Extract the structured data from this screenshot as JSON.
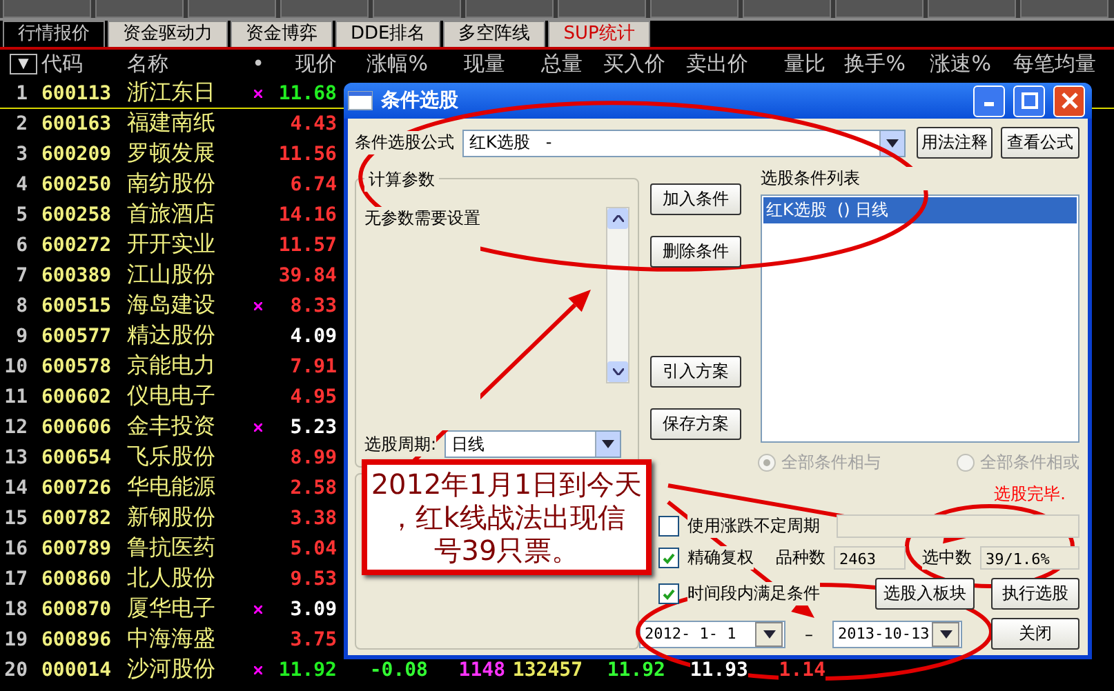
{
  "tabs": [
    {
      "label": "行情报价",
      "selected": true,
      "kind": "normal"
    },
    {
      "label": "资金驱动力",
      "selected": false,
      "kind": "normal"
    },
    {
      "label": "资金博弈",
      "selected": false,
      "kind": "normal"
    },
    {
      "label": "DDE排名",
      "selected": false,
      "kind": "normal"
    },
    {
      "label": "多空阵线",
      "selected": false,
      "kind": "normal"
    },
    {
      "label": "SUP统计",
      "selected": false,
      "kind": "alert"
    }
  ],
  "table": {
    "menu_glyph": "▼",
    "columns": [
      "代码",
      "名称",
      "•",
      "现价",
      "涨幅%",
      "现量",
      "总量",
      "买入价",
      "卖出价",
      "量比",
      "换手%",
      "涨速%",
      "每笔均量"
    ],
    "rows": [
      {
        "index": "1",
        "code": "600113",
        "name": "浙江东日",
        "flagged": true,
        "price": "11.68",
        "color": "#22ee22",
        "selected": true
      },
      {
        "index": "2",
        "code": "600163",
        "name": "福建南纸",
        "flagged": false,
        "price": "4.43",
        "color": "#ff3333",
        "selected": false
      },
      {
        "index": "3",
        "code": "600209",
        "name": "罗顿发展",
        "flagged": false,
        "price": "11.56",
        "color": "#ff3333",
        "selected": false
      },
      {
        "index": "4",
        "code": "600250",
        "name": "南纺股份",
        "flagged": false,
        "price": "6.74",
        "color": "#ff3333",
        "selected": false
      },
      {
        "index": "5",
        "code": "600258",
        "name": "首旅酒店",
        "flagged": false,
        "price": "14.16",
        "color": "#ff3333",
        "selected": false
      },
      {
        "index": "6",
        "code": "600272",
        "name": "开开实业",
        "flagged": false,
        "price": "11.57",
        "color": "#ff3333",
        "selected": false
      },
      {
        "index": "7",
        "code": "600389",
        "name": "江山股份",
        "flagged": false,
        "price": "39.84",
        "color": "#ff3333",
        "selected": false
      },
      {
        "index": "8",
        "code": "600515",
        "name": "海岛建设",
        "flagged": true,
        "price": "8.33",
        "color": "#ff3333",
        "selected": false
      },
      {
        "index": "9",
        "code": "600577",
        "name": "精达股份",
        "flagged": false,
        "price": "4.09",
        "color": "#ffffff",
        "selected": false
      },
      {
        "index": "10",
        "code": "600578",
        "name": "京能电力",
        "flagged": false,
        "price": "7.91",
        "color": "#ff3333",
        "selected": false
      },
      {
        "index": "11",
        "code": "600602",
        "name": "仪电电子",
        "flagged": false,
        "price": "4.95",
        "color": "#ff3333",
        "selected": false
      },
      {
        "index": "12",
        "code": "600606",
        "name": "金丰投资",
        "flagged": true,
        "price": "5.23",
        "color": "#ffffff",
        "selected": false
      },
      {
        "index": "13",
        "code": "600654",
        "name": "飞乐股份",
        "flagged": false,
        "price": "8.99",
        "color": "#ff3333",
        "selected": false
      },
      {
        "index": "14",
        "code": "600726",
        "name": "华电能源",
        "flagged": false,
        "price": "2.58",
        "color": "#ff3333",
        "selected": false
      },
      {
        "index": "15",
        "code": "600782",
        "name": "新钢股份",
        "flagged": false,
        "price": "3.38",
        "color": "#ff3333",
        "selected": false
      },
      {
        "index": "16",
        "code": "600789",
        "name": "鲁抗医药",
        "flagged": false,
        "price": "5.04",
        "color": "#ff3333",
        "selected": false
      },
      {
        "index": "17",
        "code": "600860",
        "name": "北人股份",
        "flagged": false,
        "price": "9.53",
        "color": "#ff3333",
        "selected": false
      },
      {
        "index": "18",
        "code": "600870",
        "name": "厦华电子",
        "flagged": true,
        "price": "3.09",
        "color": "#ffffff",
        "selected": false
      },
      {
        "index": "19",
        "code": "600896",
        "name": "中海海盛",
        "flagged": false,
        "price": "3.75",
        "color": "#ff3333",
        "selected": false
      },
      {
        "index": "20",
        "code": "000014",
        "name": "沙河股份",
        "flagged": true,
        "price": "11.92",
        "color": "#22ee22",
        "selected": false,
        "extra": [
          {
            "text": "-0.08",
            "color": "#33ff33"
          },
          {
            "text": "1148",
            "color": "#ff33ff"
          },
          {
            "text": "132457",
            "color": "#e8e860"
          },
          {
            "text": "11.92",
            "color": "#33ff33"
          },
          {
            "text": "11.93",
            "color": "#ffffff"
          },
          {
            "text": "1.14",
            "color": "#ff3333"
          }
        ]
      }
    ]
  },
  "dialog": {
    "title": "条件选股",
    "formula": {
      "label": "条件选股公式",
      "value": "红K选股   -"
    },
    "top_buttons": [
      "用法注释",
      "查看公式"
    ],
    "params": {
      "title": "计算参数",
      "message": "无参数需要设置",
      "period_label": "选股周期:",
      "period_value": "日线"
    },
    "side_buttons": [
      "加入条件",
      "删除条件",
      "引入方案",
      "保存方案"
    ],
    "conditions": {
      "label": "选股条件列表",
      "items": [
        {
          "text": "红K选股  () 日线",
          "selected": true
        }
      ]
    },
    "logic": [
      {
        "label": "全部条件相与",
        "selected": true
      },
      {
        "label": "全部条件相或",
        "selected": false
      }
    ],
    "status": "选股完毕.",
    "options": [
      {
        "label": "使用涨跌不定周期",
        "checked": false
      },
      {
        "label": "精确复权",
        "checked": true
      },
      {
        "label": "时间段内满足条件",
        "checked": true
      }
    ],
    "stats": [
      {
        "label": "品种数",
        "value": "2463"
      },
      {
        "label": "选中数",
        "value": "39/1.6%"
      }
    ],
    "action_buttons": [
      "选股入板块",
      "执行选股"
    ],
    "date_from": "2012- 1- 1",
    "date_separator": "–",
    "date_to": "2013-10-13",
    "close": "关闭"
  },
  "callout": {
    "lines": [
      "2012年1月1日到今天",
      "，红k线战法出现信",
      "号39只票。"
    ]
  }
}
